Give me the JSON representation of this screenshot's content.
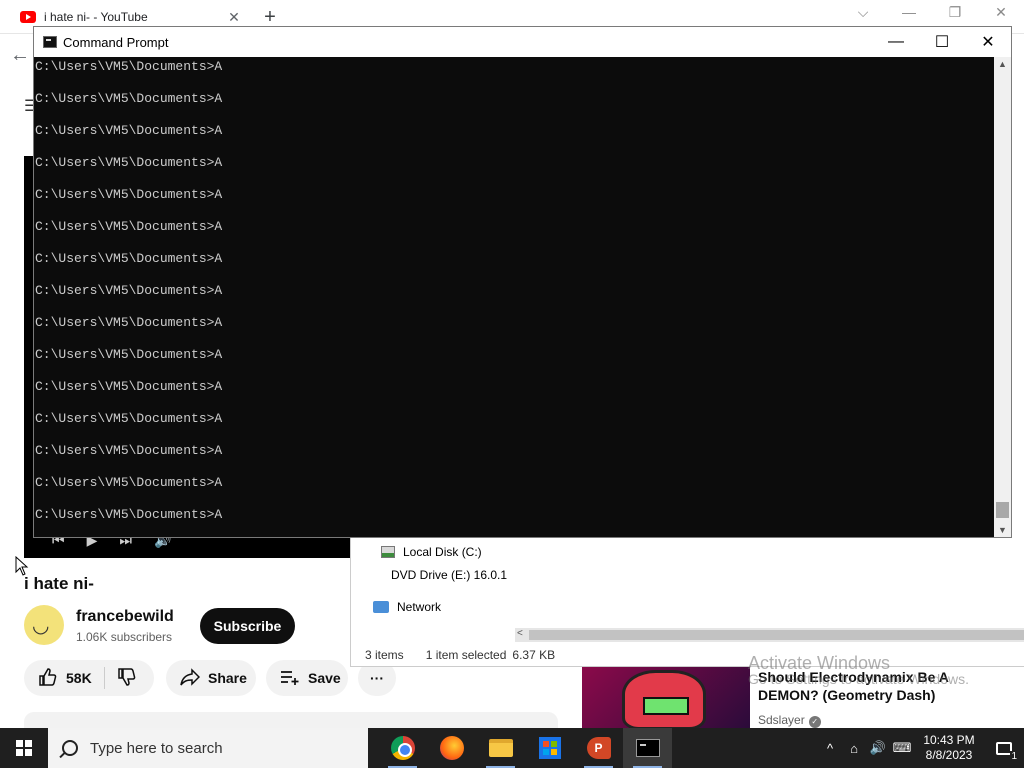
{
  "browser": {
    "tab_title": "i hate ni- - YouTube",
    "tab_close": "✕",
    "new_tab": "+",
    "back_arrow": "←",
    "menu_icon": "☰",
    "win_controls": [
      "⌵",
      "—",
      "❐",
      "✕"
    ]
  },
  "youtube": {
    "video_title": "i hate ni-",
    "channel_name": "francebewild",
    "subscribers": "1.06K subscribers",
    "subscribe_label": "Subscribe",
    "like_count": "58K",
    "share_label": "Share",
    "save_label": "Save",
    "more_label": "···",
    "player_controls": [
      "⏮",
      "▶",
      "⏭",
      "🔊"
    ],
    "recommended": {
      "title": "Should Electrodynamix Be A DEMON? (Geometry Dash)",
      "channel": "Sdslayer"
    }
  },
  "explorer": {
    "tree": [
      {
        "label": "Local Disk (C:)",
        "icon": "drive-icon"
      },
      {
        "label": "DVD Drive (E:) 16.0.1",
        "icon": "dvd-icon"
      },
      {
        "label": "Network",
        "icon": "network-icon"
      }
    ],
    "status_items": "3 items",
    "status_selected": "1 item selected",
    "status_size": "6.37 KB"
  },
  "cmd": {
    "title": "Command Prompt",
    "lines": [
      "C:\\Users\\VM5\\Documents>A",
      "C:\\Users\\VM5\\Documents>A",
      "C:\\Users\\VM5\\Documents>A",
      "C:\\Users\\VM5\\Documents>A",
      "C:\\Users\\VM5\\Documents>A",
      "C:\\Users\\VM5\\Documents>A",
      "C:\\Users\\VM5\\Documents>A",
      "C:\\Users\\VM5\\Documents>A",
      "C:\\Users\\VM5\\Documents>A",
      "C:\\Users\\VM5\\Documents>A",
      "C:\\Users\\VM5\\Documents>A",
      "C:\\Users\\VM5\\Documents>A",
      "C:\\Users\\VM5\\Documents>A",
      "C:\\Users\\VM5\\Documents>A",
      "C:\\Users\\VM5\\Documents>A"
    ],
    "controls": {
      "minimize": "—",
      "maximize": "☐",
      "close": "✕"
    }
  },
  "watermark": {
    "title": "Activate Windows",
    "subtitle": "Go to Settings to activate Windows."
  },
  "taskbar": {
    "search_placeholder": "Type here to search",
    "apps": [
      "chrome-icon",
      "firefox-icon",
      "file-explorer-icon",
      "microsoft-store-icon",
      "powerpoint-icon",
      "command-prompt-icon"
    ],
    "ppt_letter": "P",
    "time": "10:43 PM",
    "date": "8/8/2023",
    "notification_count": "1",
    "tray_icons": [
      "^",
      "⌂",
      "🔊",
      "⌨"
    ]
  },
  "colors": {
    "cmd_bg": "#0c0c0c",
    "cmd_text": "#cccccc",
    "taskbar": "#1f1f1f",
    "youtube_red": "#ff0000"
  }
}
